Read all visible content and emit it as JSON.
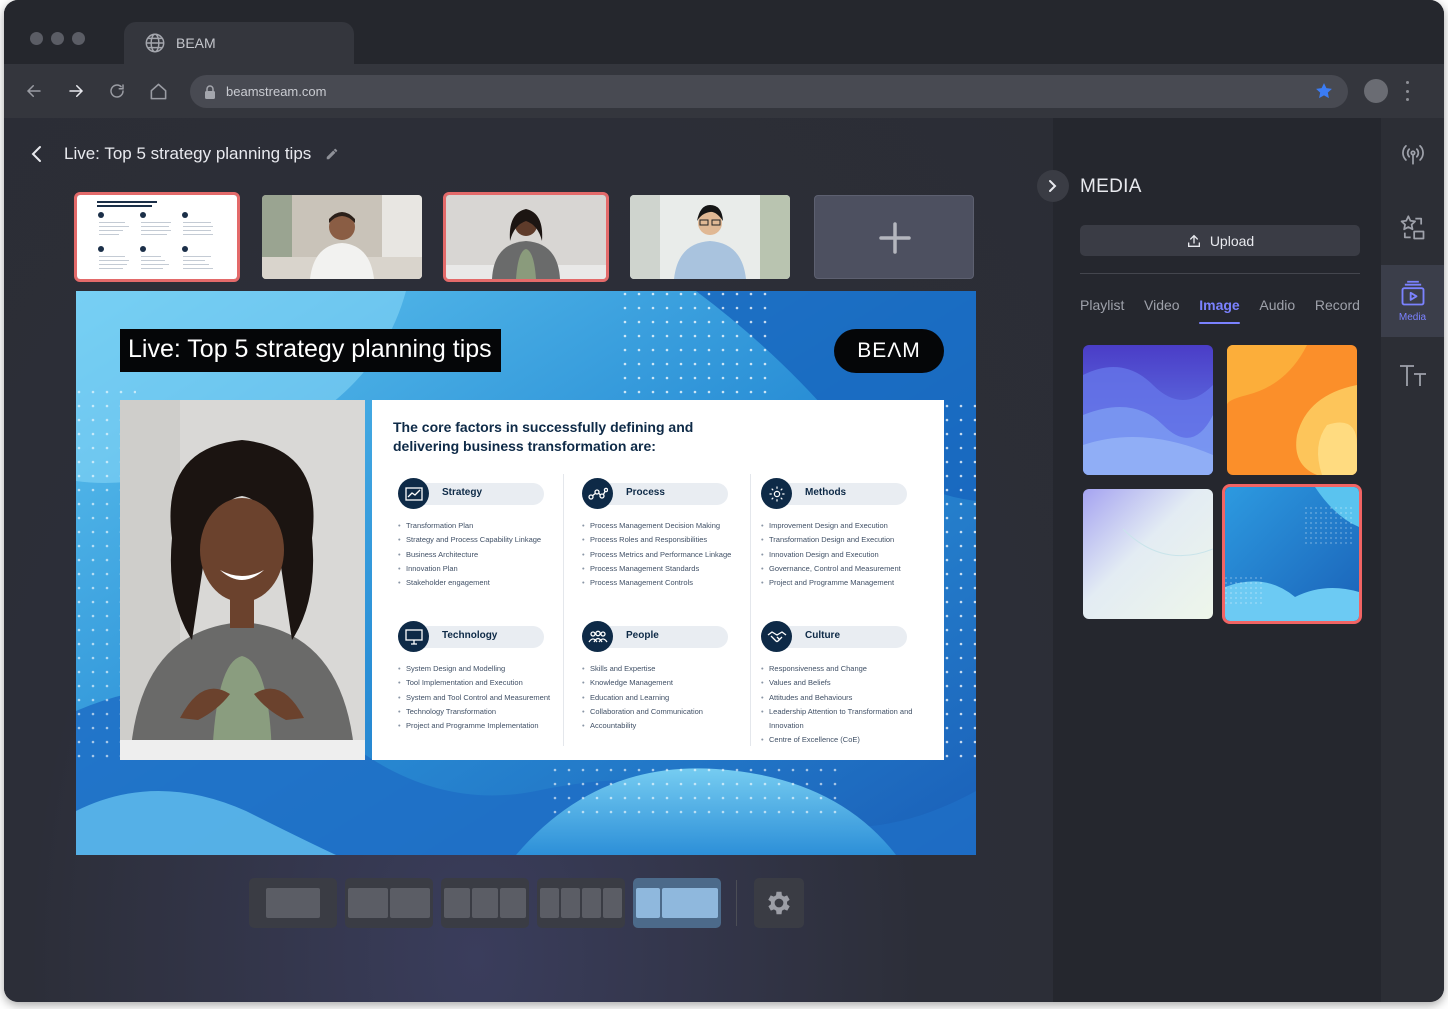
{
  "browser": {
    "tab_title": "BEAM",
    "url": "beamstream.com"
  },
  "editor": {
    "title": "Live: Top 5 strategy planning tips"
  },
  "stage": {
    "title": "Live: Top 5 strategy planning tips",
    "logo": "BEΛM",
    "doc": {
      "heading": "The core factors in successfully defining and delivering business transformation are:",
      "factors": [
        {
          "name": "Strategy",
          "icon": "chart-icon",
          "items": [
            "Transformation Plan",
            "Strategy and Process Capability Linkage",
            "Business Architecture",
            "Innovation Plan",
            "Stakeholder engagement"
          ]
        },
        {
          "name": "Process",
          "icon": "network-icon",
          "items": [
            "Process Management Decision Making",
            "Process Roles and Responsibilities",
            "Process Metrics and Performance Linkage",
            "Process Management Standards",
            "Process Management Controls"
          ]
        },
        {
          "name": "Methods",
          "icon": "cog-icon",
          "items": [
            "Improvement Design and Execution",
            "Transformation Design and Execution",
            "Innovation Design and Execution",
            "Governance, Control and Measurement",
            "Project and Programme Management"
          ]
        },
        {
          "name": "Technology",
          "icon": "monitor-icon",
          "items": [
            "System Design and Modelling",
            "Tool Implementation and Execution",
            "System and Tool Control and Measurement",
            "Technology Transformation",
            "Project and Programme Implementation"
          ]
        },
        {
          "name": "People",
          "icon": "people-icon",
          "items": [
            "Skills and Expertise",
            "Knowledge Management",
            "Education and Learning",
            "Collaboration and Communication",
            "Accountability"
          ]
        },
        {
          "name": "Culture",
          "icon": "handshake-icon",
          "items": [
            "Responsiveness and Change",
            "Values and Beliefs",
            "Attitudes and Behaviours",
            "Leadership Attention to Transformation and Innovation",
            "Centre of Excellence (CoE)"
          ]
        }
      ]
    }
  },
  "media_panel": {
    "title": "MEDIA",
    "upload_label": "Upload",
    "tabs": [
      "Playlist",
      "Video",
      "Image",
      "Audio",
      "Record"
    ],
    "active_tab": "Image"
  },
  "rail": {
    "media_label": "Media"
  },
  "colors": {
    "accent": "#7b82ff",
    "selection": "#f26464",
    "doc_navy": "#0e2a47"
  }
}
